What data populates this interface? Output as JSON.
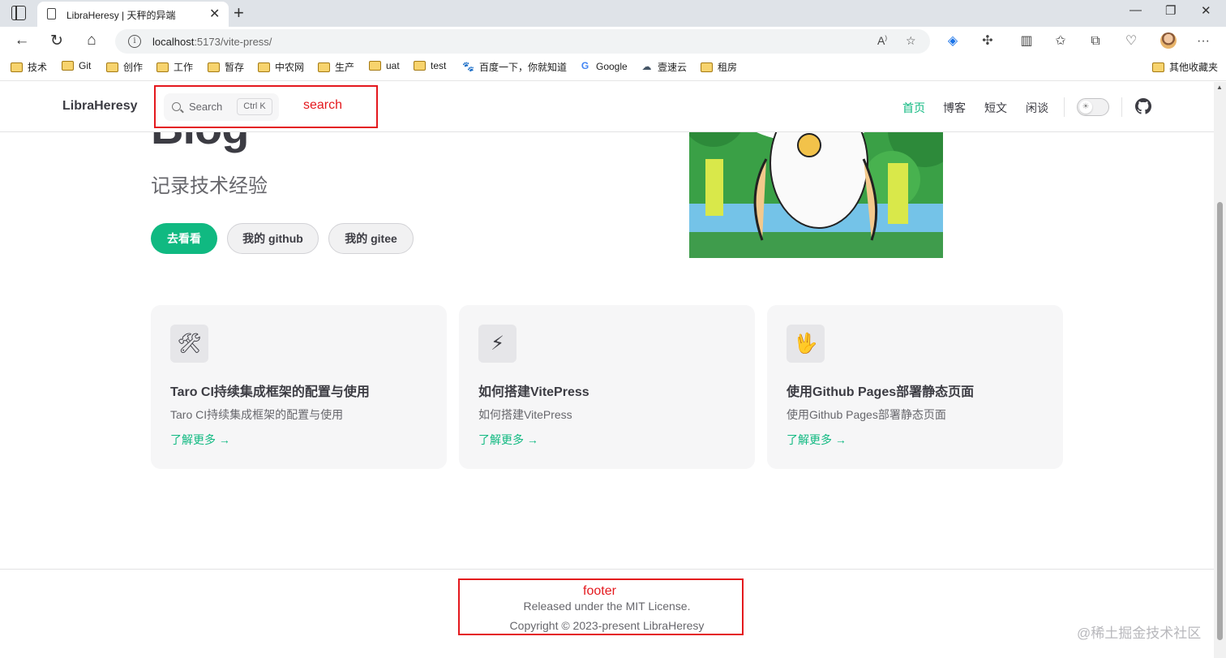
{
  "browser": {
    "tab_title": "LibraHeresy | 天秤的异端",
    "tab_close": "✕",
    "new_tab": "+",
    "minimize": "—",
    "restore": "❐",
    "close": "✕",
    "url_host": "localhost",
    "url_rest": ":5173/vite-press/",
    "more_menu": "···",
    "bookmarks": [
      {
        "label": "技术",
        "icon": "folder"
      },
      {
        "label": "Git",
        "icon": "folder"
      },
      {
        "label": "创作",
        "icon": "folder"
      },
      {
        "label": "工作",
        "icon": "folder"
      },
      {
        "label": "暂存",
        "icon": "folder"
      },
      {
        "label": "中农网",
        "icon": "folder"
      },
      {
        "label": "生产",
        "icon": "folder"
      },
      {
        "label": "uat",
        "icon": "folder"
      },
      {
        "label": "test",
        "icon": "folder"
      },
      {
        "label": "百度一下，你就知道",
        "icon": "baidu-icon"
      },
      {
        "label": "Google",
        "icon": "google-icon"
      },
      {
        "label": "壹速云",
        "icon": "cloud-icon"
      },
      {
        "label": "租房",
        "icon": "folder"
      }
    ],
    "other_bookmarks": "其他收藏夹"
  },
  "nav": {
    "title": "LibraHeresy",
    "search_label": "Search",
    "search_shortcut": "Ctrl K",
    "links": [
      "首页",
      "博客",
      "短文",
      "闲谈"
    ],
    "active_link": "首页"
  },
  "annotations": {
    "search": "search",
    "footer": "footer"
  },
  "hero": {
    "title": "Blog",
    "tagline": "记录技术经验",
    "actions": [
      "去看看",
      "我的 github",
      "我的 gitee"
    ]
  },
  "features": [
    {
      "icon": "tools-icon",
      "glyph": "🛠",
      "title": "Taro CI持续集成框架的配置与使用",
      "details": "Taro CI持续集成框架的配置与使用",
      "link": "了解更多 →"
    },
    {
      "icon": "lightning-icon",
      "glyph": "⚡",
      "title": "如何搭建VitePress",
      "details": "如何搭建VitePress",
      "link": "了解更多 →"
    },
    {
      "icon": "vulcan-hand-icon",
      "glyph": "🖖",
      "title": "使用Github Pages部署静态页面",
      "details": "使用Github Pages部署静态页面",
      "link": "了解更多 →"
    }
  ],
  "footer": {
    "message": "Released under the MIT License.",
    "copyright": "Copyright © 2023-present LibraHeresy"
  },
  "watermark": "@稀土掘金技术社区",
  "colors": {
    "brand": "#10b981",
    "annotation": "#e4181d"
  }
}
